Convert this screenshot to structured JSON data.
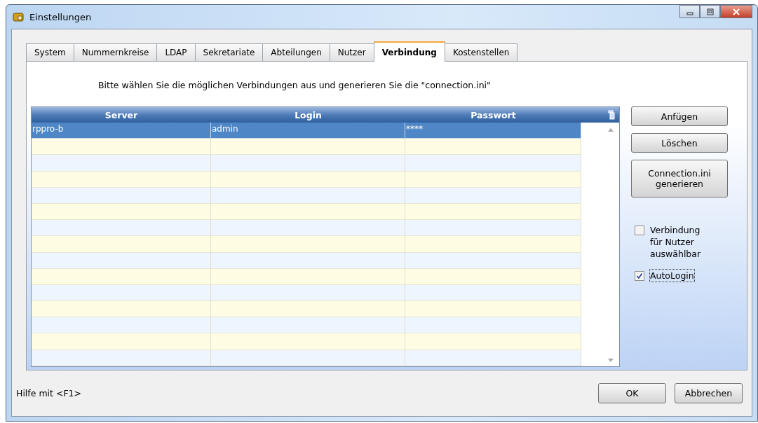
{
  "window": {
    "title": "Einstellungen"
  },
  "tabs": [
    {
      "label": "System",
      "selected": false
    },
    {
      "label": "Nummernkreise",
      "selected": false
    },
    {
      "label": "LDAP",
      "selected": false
    },
    {
      "label": "Sekretariate",
      "selected": false
    },
    {
      "label": "Abteilungen",
      "selected": false
    },
    {
      "label": "Nutzer",
      "selected": false
    },
    {
      "label": "Verbindung",
      "selected": true
    },
    {
      "label": "Kostenstellen",
      "selected": false
    }
  ],
  "instruction": "Bitte wählen Sie die möglichen Verbindungen aus und generieren Sie die \"connection.ini\"",
  "table": {
    "columns": [
      "Server",
      "Login",
      "Passwort"
    ],
    "rows": [
      {
        "cells": [
          "rppro-b",
          "admin",
          "****"
        ],
        "selected": true
      }
    ]
  },
  "actions": [
    {
      "label": "Anfügen"
    },
    {
      "label": "Löschen"
    },
    {
      "label": "Connection.ini generieren"
    }
  ],
  "options": [
    {
      "label": "Verbindung für Nutzer auswählbar",
      "checked": false,
      "focused": false
    },
    {
      "label": "AutoLogin",
      "checked": true,
      "focused": true
    }
  ],
  "status_bar": "Hilfe mit <F1>",
  "buttons": [
    {
      "label": "OK"
    },
    {
      "label": "Abbrechen"
    }
  ]
}
